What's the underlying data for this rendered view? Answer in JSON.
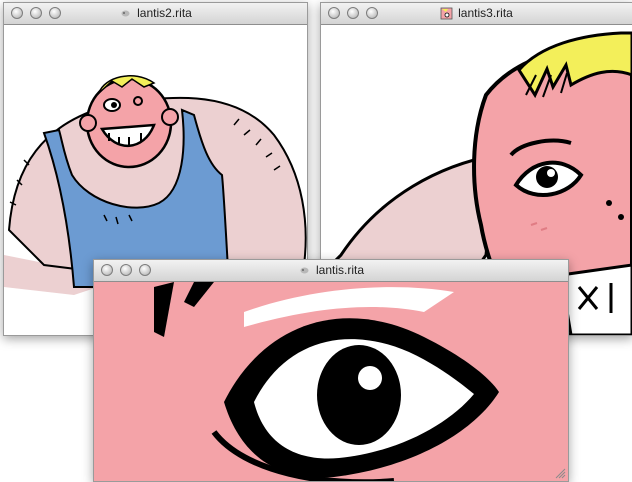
{
  "windows": [
    {
      "title": "lantis2.rita",
      "icon": "document-icon"
    },
    {
      "title": "lantis3.rita",
      "icon": "drawing-proxy-icon"
    },
    {
      "title": "lantis.rita",
      "icon": "document-icon"
    }
  ],
  "colors": {
    "skin_pink": "#f4a3a8",
    "body_pink": "#ecd0d1",
    "tanktop_blue": "#6c9bd2",
    "hair_yellow": "#f3ef5a",
    "line_black": "#000000"
  }
}
